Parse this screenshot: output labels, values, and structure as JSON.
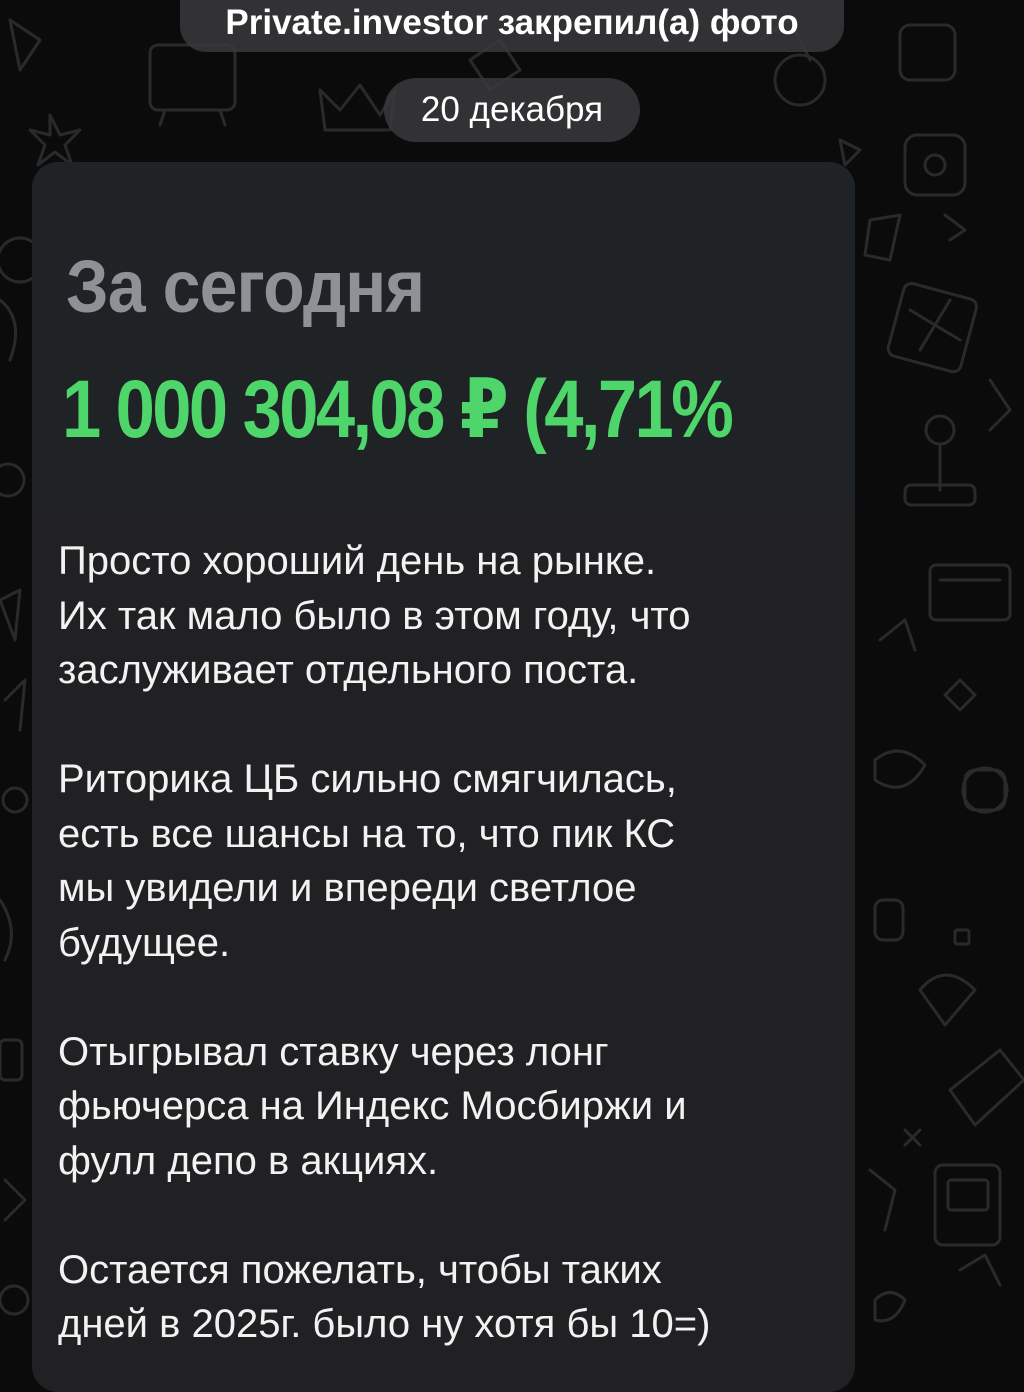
{
  "service_message": "Private.investor закрепил(а) фото",
  "date_label": "20 декабря",
  "photo": {
    "title": "За сегодня",
    "amount": "1 000 304,08 ₽ (4,71%"
  },
  "message": {
    "paragraphs": [
      [
        "Просто хороший день на рынке.",
        "Их так мало было в этом году, что",
        "заслуживает отдельного поста."
      ],
      [
        "Риторика ЦБ сильно смягчилась,",
        "есть все шансы на то, что пик КС",
        "мы увидели и впереди светлое",
        "будущее."
      ],
      [
        "Отыгрывал ставку через лонг",
        "фьючерса на Индекс Мосбиржи и",
        "фулл депо в акциях."
      ],
      [
        "Остается пожелать, чтобы таких",
        "дней в 2025г. было ну хотя бы 10=)"
      ]
    ]
  },
  "colors": {
    "background": "#0b0b0c",
    "bubble": "#212124",
    "pill": "#3a3a3c",
    "amount_green": "#4fd66b",
    "title_gray": "#8e9296"
  }
}
